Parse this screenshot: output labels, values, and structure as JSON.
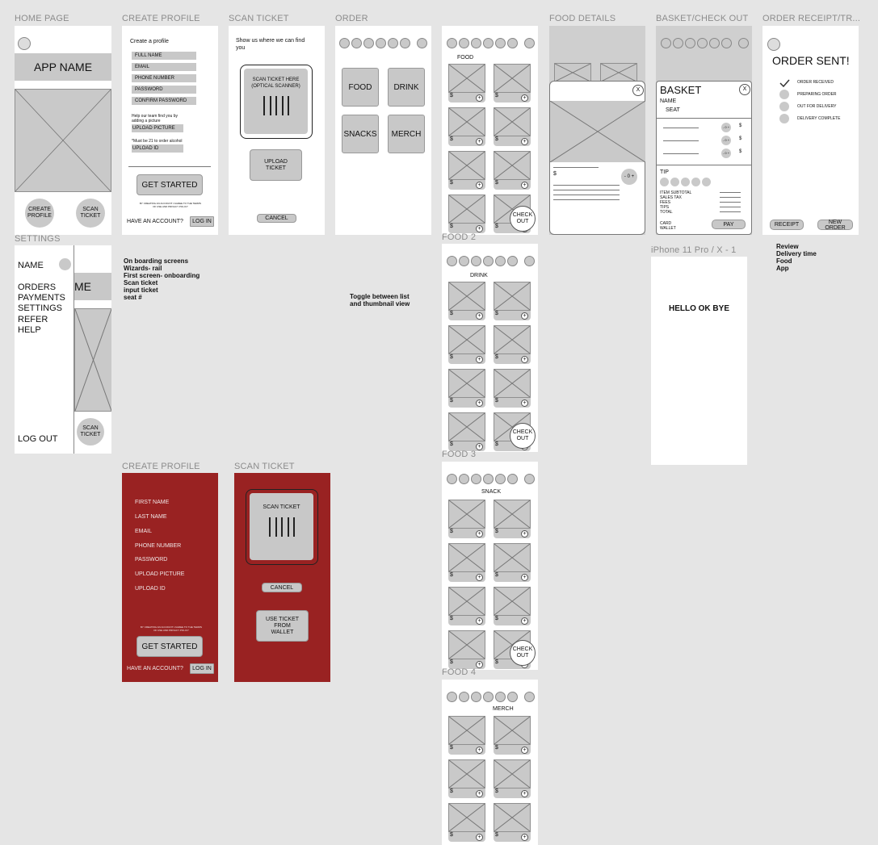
{
  "frames": {
    "home": {
      "label": "HOME PAGE",
      "app_name": "APP NAME",
      "create_profile": "CREATE PROFILE",
      "scan_ticket": "SCAN TICKET"
    },
    "create_profile": {
      "label": "CREATE PROFILE",
      "heading": "Create a profile",
      "fields": [
        "FULL NAME",
        "EMAIL",
        "PHONE NUMBER",
        "PASSWORD",
        "CONFIRM PASSWORD"
      ],
      "help_text": "Help our team find you by adding a picture",
      "upload_picture": "UPLOAD PICTURE",
      "alcohol_note": "*Must be 21 to order alcohol",
      "upload_id": "UPLOAD ID",
      "get_started": "GET STARTED",
      "terms": "BY CREATING AN ACCOUNT I AGREE TO THE TERMS OF USE AND PRIVACY POLICY",
      "have_account": "HAVE AN ACCOUNT?",
      "log_in": "LOG IN"
    },
    "scan_ticket": {
      "label": "SCAN TICKET",
      "heading": "Show us where we can find you",
      "scanner_text": "SCAN TICKET HERE (OPTICAL SCANNER)",
      "upload": "UPLOAD TICKET",
      "cancel": "CANCEL"
    },
    "order": {
      "label": "ORDER",
      "categories": [
        "FOOD",
        "DRINK",
        "SNACKS",
        "MERCH"
      ]
    },
    "food_list": {
      "title": "FOOD",
      "tabs": [
        "FOOD",
        "DRINK",
        "SNACK",
        "MERCH"
      ],
      "price": "$",
      "plus": "+",
      "checkout": "CHECK OUT"
    },
    "food2": {
      "label": "FOOD 2",
      "title": "DRINK"
    },
    "food3": {
      "label": "FOOD 3",
      "title": "SNACK"
    },
    "food4": {
      "label": "FOOD 4",
      "title": "MERCH"
    },
    "food_details": {
      "label": "FOOD DETAILS",
      "close": "X",
      "price": "$",
      "stepper": "- 0 +"
    },
    "basket": {
      "label": "BASKET/CHECK OUT",
      "title": "BASKET",
      "name": "NAME",
      "seat": "SEAT",
      "close": "X",
      "item_stepper": "- 0 +",
      "item_price": "$",
      "tip": "TIP",
      "totals": [
        "ITEM SUBTOTAL",
        "SALES TAX",
        "FEES",
        "TIPS",
        "TOTAL"
      ],
      "card": "CARD",
      "wallet": "WALLET",
      "pay": "PAY"
    },
    "receipt": {
      "label": "ORDER RECEIPT/TR...",
      "title": "ORDER SENT!",
      "steps": [
        "ORDER RECEIVED",
        "PREPARING ORDER",
        "OUT FOR DELIVERY",
        "DELIVERY COMPLETE"
      ],
      "receipt_btn": "RECEIPT",
      "new_order": "NEW ORDER"
    },
    "settings": {
      "label": "SETTINGS",
      "name": "NAME",
      "menu": [
        "ORDERS",
        "PAYMENTS",
        "SETTINGS",
        "REFER",
        "HELP"
      ],
      "log_out": "LOG OUT",
      "bg_title": "ME",
      "scan_ticket": "SCAN TICKET"
    },
    "iphone": {
      "label": "iPhone 11 Pro / X - 1",
      "text": "HELLO OK BYE"
    },
    "create_profile_red": {
      "label": "CREATE PROFILE",
      "fields": [
        "FIRST NAME",
        "LAST NAME",
        "EMAIL",
        "PHONE NUMBER",
        "PASSWORD",
        "UPLOAD PICTURE",
        "UPLOAD ID"
      ],
      "terms": "BY CREATING AN ACCOUNT I AGREE TO THE TERMS OF USE AND PRIVACY POLICY",
      "get_started": "GET STARTED",
      "have_account": "HAVE AN ACCOUNT?",
      "log_in": "LOG IN"
    },
    "scan_ticket_red": {
      "label": "SCAN TICKET",
      "scanner_text": "SCAN TICKET",
      "cancel": "CANCEL",
      "use_wallet": "USE TICKET FROM WALLET"
    }
  },
  "notes": {
    "onboarding": "On boarding screens\nWizards- rail\nFirst screen- onboarding\nScan ticket\ninput ticket\nseat #",
    "toggle": "Toggle between list\nand thumbnail view",
    "review": "Review\nDelivery time\nFood\nApp"
  },
  "colors": {
    "canvas": "#e5e5e5",
    "frame": "#ffffff",
    "wire_gray": "#c8c8c8",
    "accent_red": "#992222"
  }
}
